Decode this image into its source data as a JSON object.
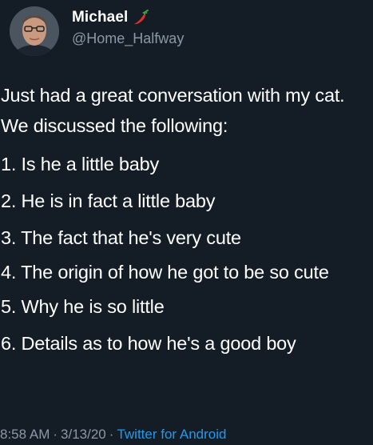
{
  "author": {
    "display_name": "Michael",
    "handle": "@Home_Halfway",
    "badge_icon": "chili-pepper-icon"
  },
  "tweet": {
    "intro": "Just had a great conversation with my cat. We discussed the following:",
    "items": [
      "1. Is he a little baby",
      "2. He is in fact a little baby",
      "3. The fact that he's very cute",
      "4. The origin of how he got to be so cute",
      "5. Why he is so little",
      "6. Details as to how he's a good boy"
    ]
  },
  "meta": {
    "time": "8:58 AM",
    "date": "3/13/20",
    "separator": "·",
    "source": "Twitter for Android"
  },
  "colors": {
    "background": "#141d26",
    "text": "#ffffff",
    "secondary": "#8b98a5",
    "link": "#1d9bf0",
    "chili": "#e0302a"
  }
}
